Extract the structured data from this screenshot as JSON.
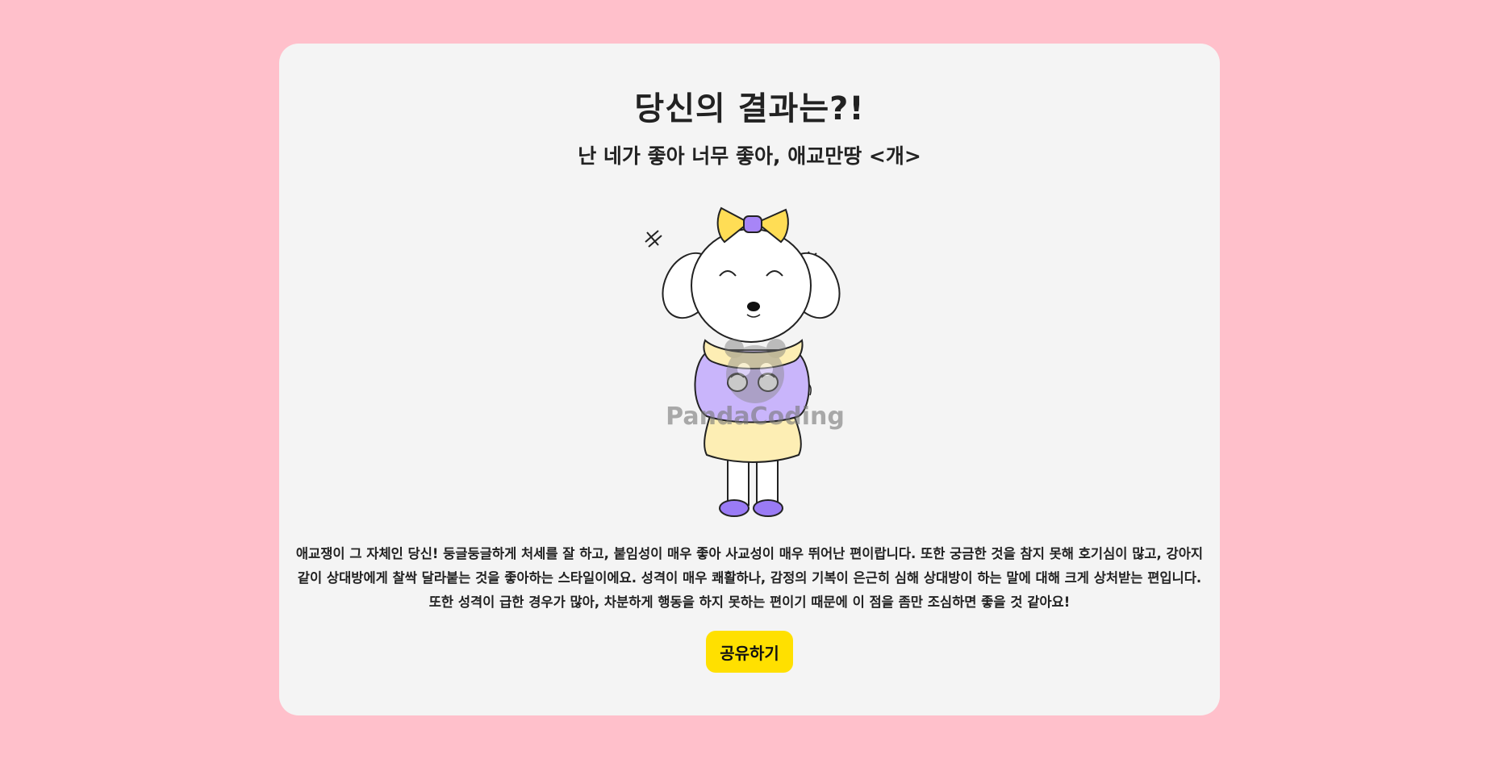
{
  "result": {
    "heading": "당신의 결과는?!",
    "subtitle": "난 네가 좋아 너무 좋아, 애교만땅 <개>",
    "description": "애교쟁이 그 자체인 당신! 둥글둥글하게 처세를 잘 하고, 붙임성이 매우 좋아 사교성이 매우 뛰어난 편이랍니다. 또한 궁금한 것을 참지 못해 호기심이 많고, 강아지같이 상대방에게 찰싹 달라붙는 것을 좋아하는 스타일이에요. 성격이 매우 쾌활하나, 감정의 기복이 은근히 심해 상대방이 하는 말에 대해 크게 상처받는 편입니다. 또한 성격이 급한 경우가 많아, 차분하게 행동을 하지 못하는 편이기 때문에 이 점을 좀만 조심하면 좋을 것 같아요!",
    "watermark": "PandaCoding",
    "share_label": "공유하기"
  },
  "colors": {
    "background": "#ffc0cb",
    "card": "#f4f4f4",
    "share_button": "#ffe000",
    "sweater": "#c9b5fb",
    "skirt": "#fdeeb4",
    "bow": "#ffdd55",
    "shoes": "#9a7bf5"
  },
  "icons": {
    "illustration": "dog-character-illustration"
  }
}
